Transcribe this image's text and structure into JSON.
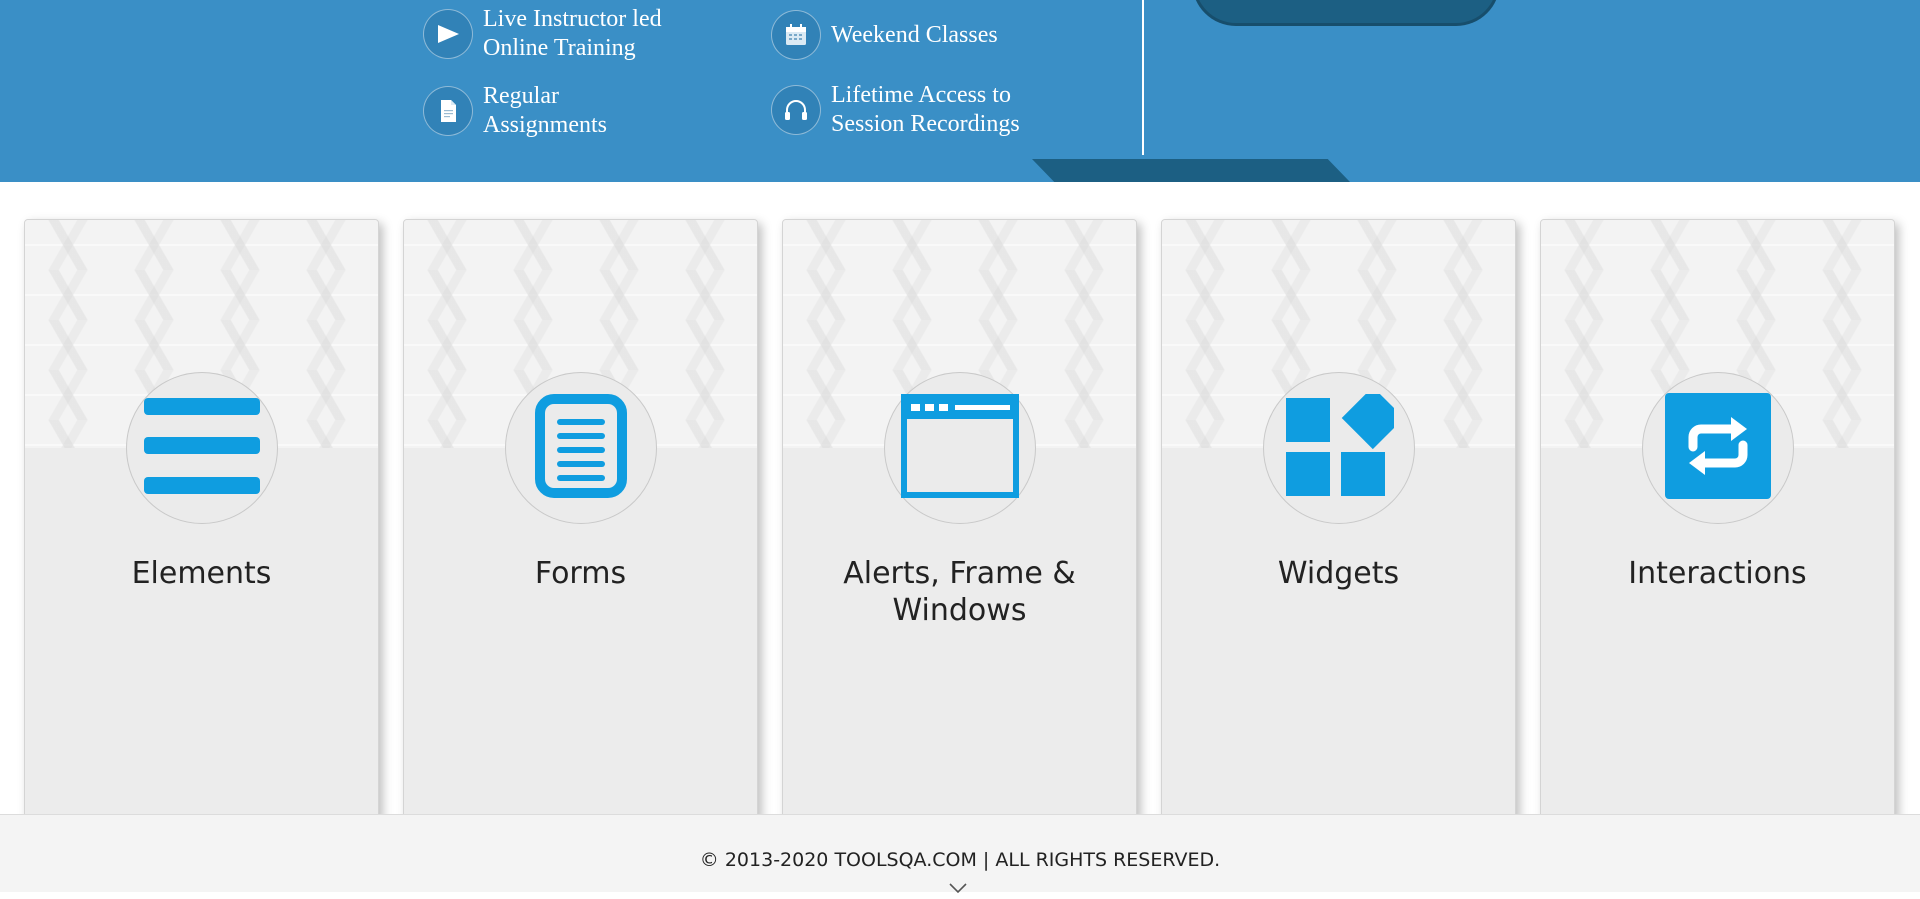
{
  "banner": {
    "features": [
      {
        "icon": "play-icon",
        "line1": "Live Instructor led",
        "line2": "Online Training"
      },
      {
        "icon": "calendar-icon",
        "line1": "Weekend Classes",
        "line2": ""
      },
      {
        "icon": "document-icon",
        "line1": "Regular",
        "line2": "Assignments"
      },
      {
        "icon": "headphones-icon",
        "line1": "Lifetime Access to",
        "line2": "Session Recordings"
      }
    ],
    "colors": {
      "background": "#3a8fc6",
      "accent_dark": "#1c5f83"
    }
  },
  "cards": [
    {
      "title": "Elements",
      "icon": "hamburger-menu-icon"
    },
    {
      "title": "Forms",
      "icon": "form-document-icon"
    },
    {
      "title": "Alerts, Frame & Windows",
      "icon": "browser-window-icon"
    },
    {
      "title": "Widgets",
      "icon": "widgets-blocks-icon"
    },
    {
      "title": "Interactions",
      "icon": "swap-arrows-icon"
    }
  ],
  "icon_color": "#0f9de0",
  "footer": {
    "copyright": "© 2013-2020 TOOLSQA.COM | ALL RIGHTS RESERVED.",
    "scroll_icon": "chevron-down-icon"
  }
}
